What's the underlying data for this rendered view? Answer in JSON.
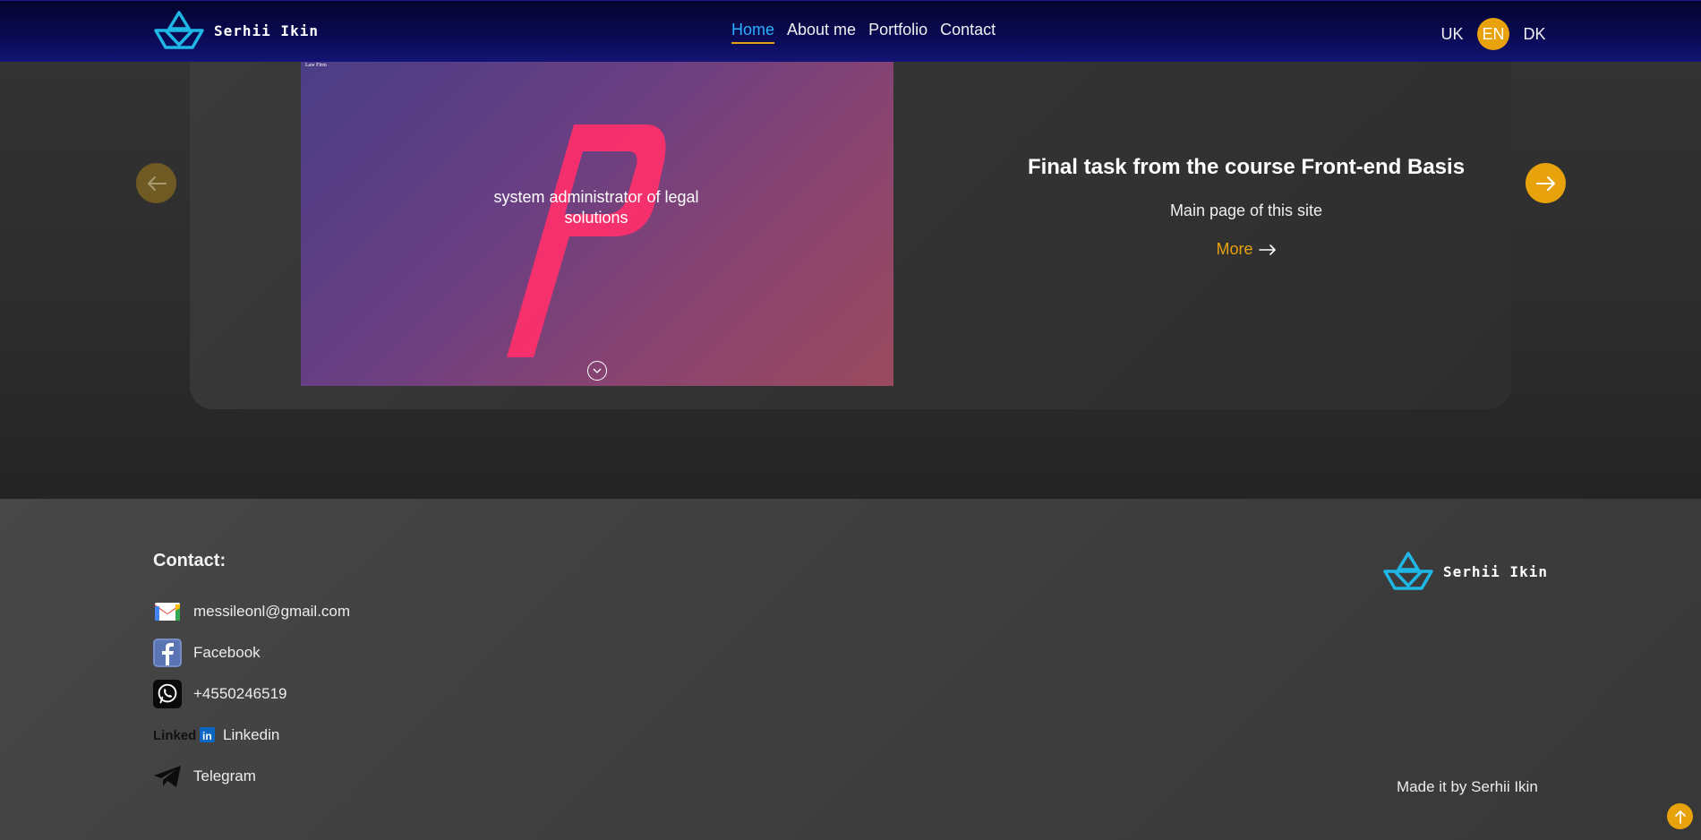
{
  "header": {
    "logo_text": "Serhii Ikin",
    "nav": [
      {
        "label": "Home",
        "active": true
      },
      {
        "label": "About me",
        "active": false
      },
      {
        "label": "Portfolio",
        "active": false
      },
      {
        "label": "Contact",
        "active": false
      }
    ],
    "languages": [
      {
        "label": "UK",
        "active": false
      },
      {
        "label": "EN",
        "active": true
      },
      {
        "label": "DK",
        "active": false
      }
    ]
  },
  "slider": {
    "image_caption": "system administrator of legal solutions",
    "image_logo_text": "Law Firm",
    "title": "Final task from the course Front-end Basis",
    "subtitle": "Main page of this site",
    "more_label": "More",
    "prev_icon": "arrow-left-icon",
    "next_icon": "arrow-right-icon"
  },
  "footer": {
    "title": "Contact:",
    "contacts": [
      {
        "label": "messileonl@gmail.com",
        "icon": "gmail-icon"
      },
      {
        "label": "Facebook",
        "icon": "facebook-icon"
      },
      {
        "label": "+4550246519",
        "icon": "whatsapp-icon"
      },
      {
        "label": "Linkedin",
        "icon": "linkedin-icon"
      },
      {
        "label": "Telegram",
        "icon": "telegram-icon"
      }
    ],
    "logo_text": "Serhii Ikin",
    "made_by": "Made it by Serhii Ikin"
  },
  "colors": {
    "accent": "#e8a20c",
    "nav_active": "#2ab0ff",
    "logo_blue": "#1fb8e6",
    "header_bg": "#0a0a55"
  }
}
